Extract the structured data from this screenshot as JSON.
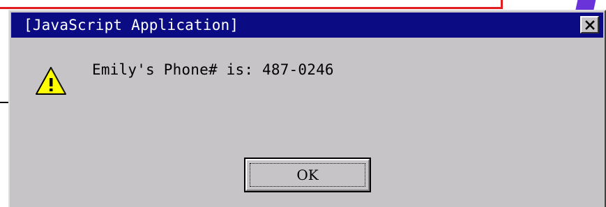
{
  "dialog": {
    "title": "[JavaScript Application]",
    "message": "Emily's Phone# is: 487-0246",
    "ok_label": "OK",
    "icon": "warning-icon",
    "close_icon": "close-icon"
  },
  "colors": {
    "title_bar": "#0b0c83",
    "dialog_face": "#c7c4c7",
    "warning_yellow": "#ffff00",
    "background_accent_red": "#e21d1d",
    "background_accent_purple": "#6a33d9"
  }
}
